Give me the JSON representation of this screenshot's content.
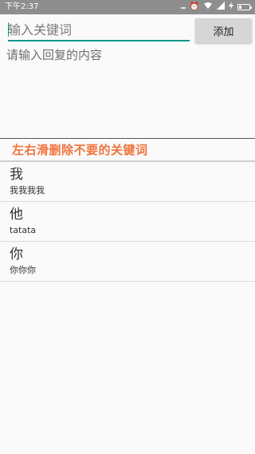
{
  "status_bar": {
    "time": "下午2:37",
    "icons": [
      "signal-dots-icon",
      "alarm-icon",
      "wifi-icon",
      "signal-icon",
      "charging-icon",
      "battery-icon"
    ]
  },
  "keyword_input": {
    "value": "",
    "placeholder": "输入关键词"
  },
  "add_button": {
    "label": "添加"
  },
  "reply_input": {
    "value": "",
    "placeholder": "请输入回复的内容"
  },
  "hint": {
    "text": "左右滑删除不要的关键词",
    "color": "#f0733c"
  },
  "accent_color": "#009688",
  "keywords": [
    {
      "keyword": "我",
      "reply": "我我我我"
    },
    {
      "keyword": "他",
      "reply": "tatata"
    },
    {
      "keyword": "你",
      "reply": "你你你"
    }
  ]
}
